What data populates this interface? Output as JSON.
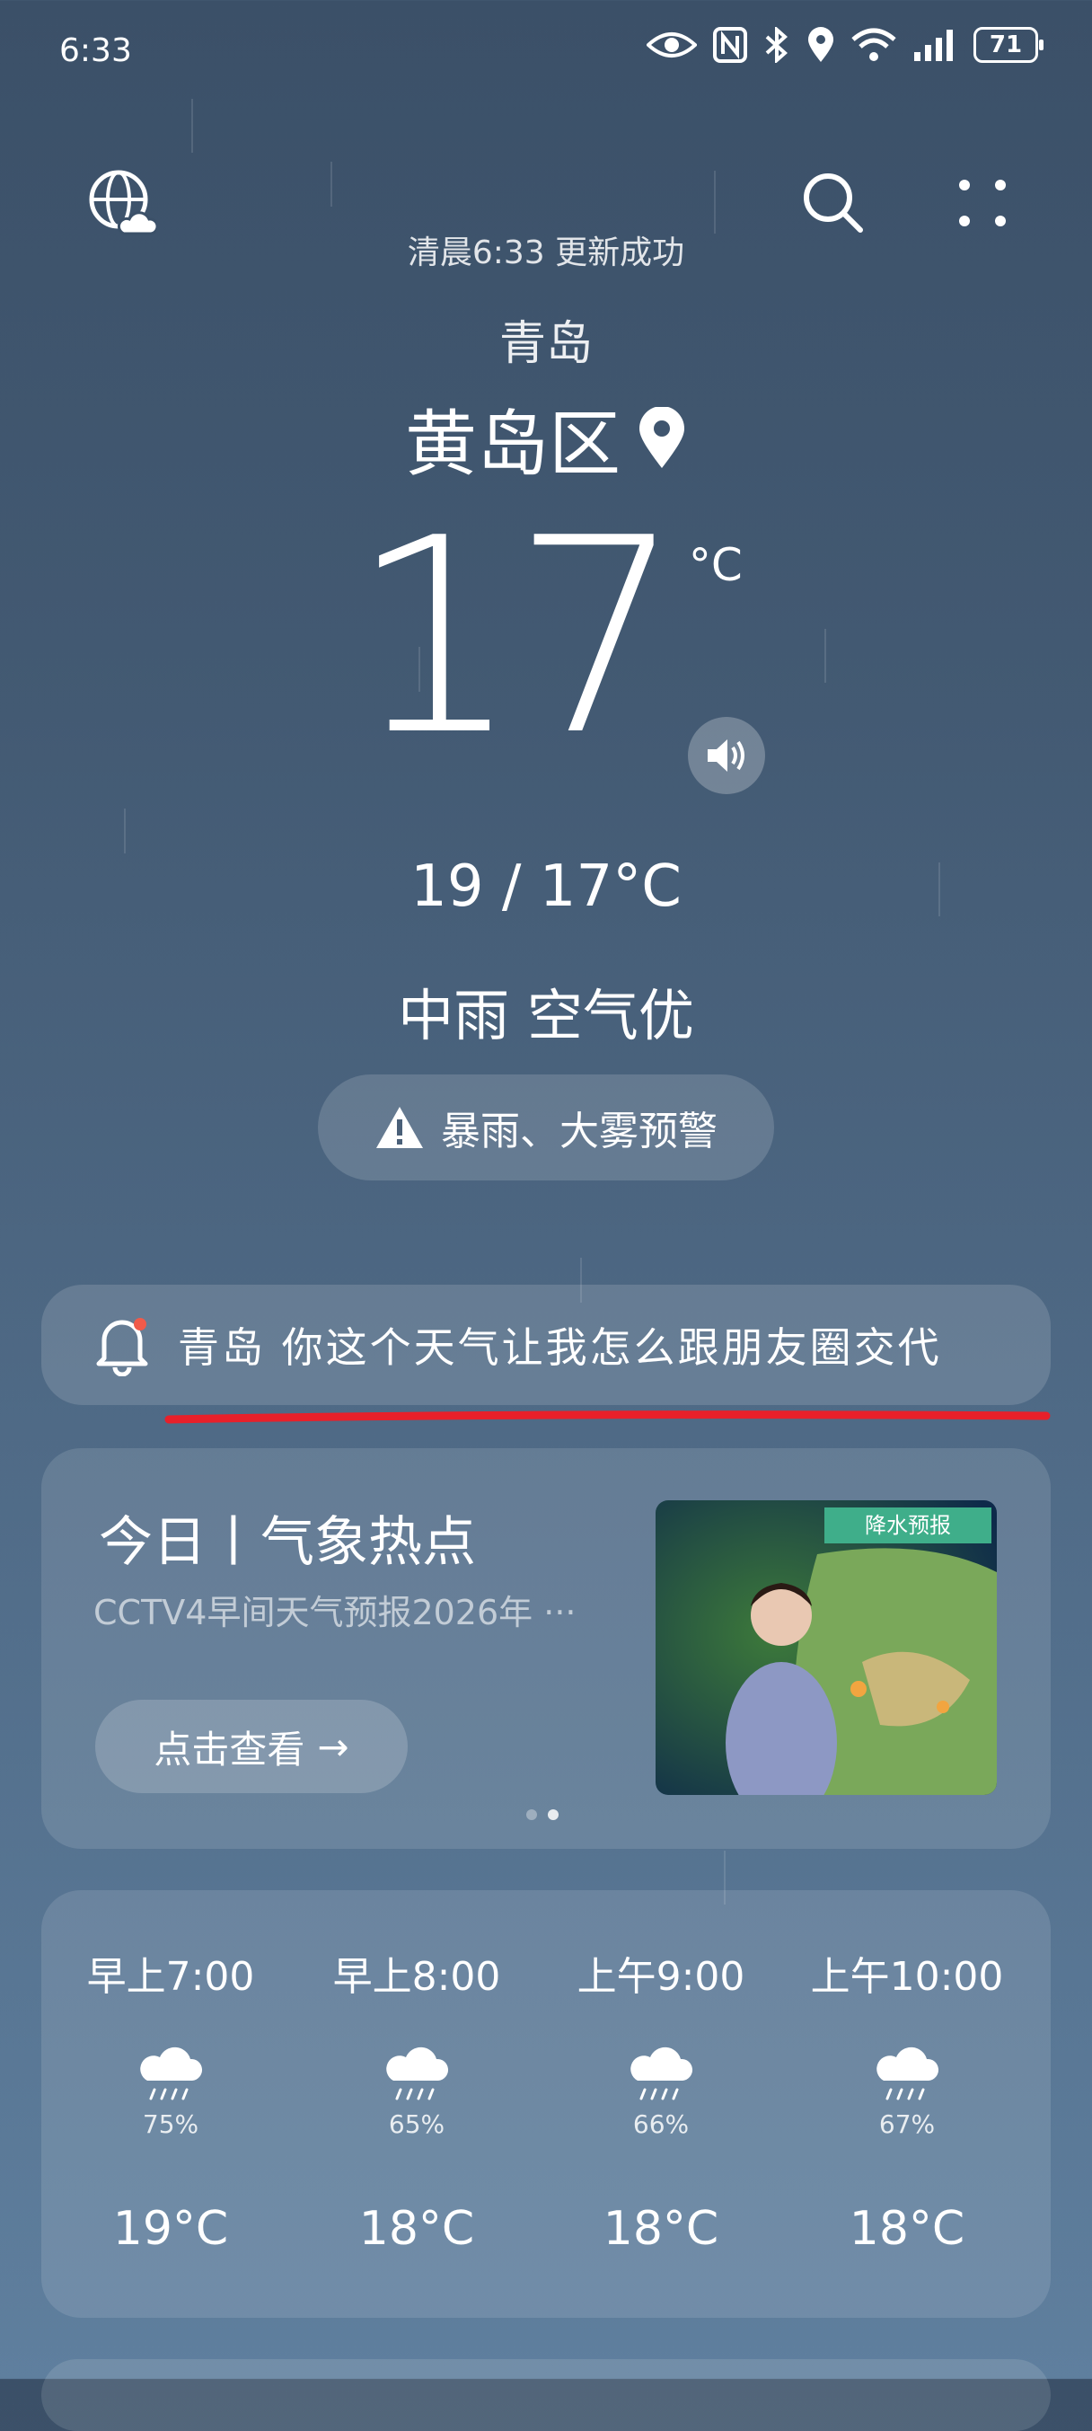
{
  "status_bar": {
    "time": "6:33",
    "battery": "71"
  },
  "header": {
    "update_text": "清晨6:33 更新成功",
    "city": "青岛",
    "district": "黄岛区"
  },
  "current": {
    "temperature": "17",
    "unit": "°C",
    "range": "19 / 17°C",
    "condition": "中雨 空气优",
    "alert": "暴雨、大雾预警"
  },
  "notice": {
    "text": "青岛 你这个天气让我怎么跟朋友圈交代"
  },
  "hot_card": {
    "title": "今日丨气象热点",
    "subtitle": "CCTV4早间天气预报2026年 ···",
    "button_label": "点击查看",
    "button_arrow": "→",
    "thumbnail_caption": "降水预报"
  },
  "hourly": [
    {
      "time": "早上7:00",
      "icon": "rain-icon",
      "precip": "75%",
      "temp": "19°C"
    },
    {
      "time": "早上8:00",
      "icon": "rain-icon",
      "precip": "65%",
      "temp": "18°C"
    },
    {
      "time": "上午9:00",
      "icon": "rain-icon",
      "precip": "66%",
      "temp": "18°C"
    },
    {
      "time": "上午10:00",
      "icon": "rain-icon",
      "precip": "67%",
      "temp": "18°C"
    }
  ],
  "colors": {
    "alert_underline": "#e8202a"
  }
}
